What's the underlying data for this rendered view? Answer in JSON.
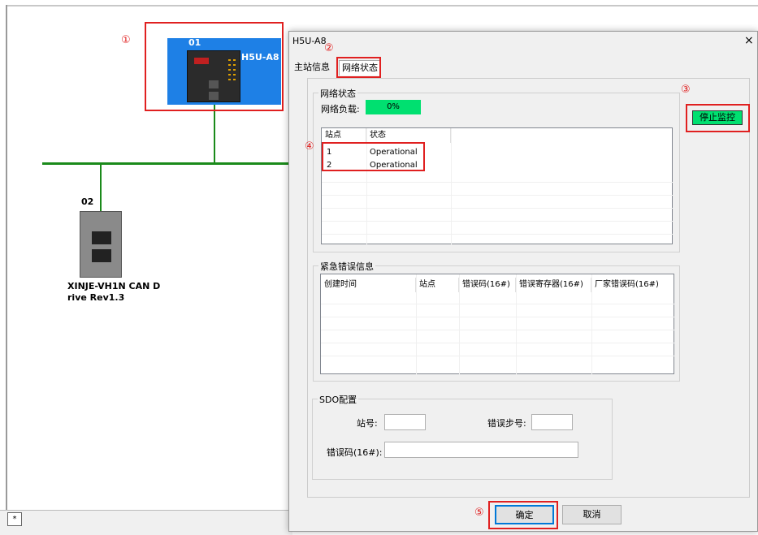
{
  "canvas": {
    "device1": {
      "number": "01",
      "name": "H5U-A8"
    },
    "device2": {
      "number": "02",
      "name_line1": "XINJE-VH1N CAN D",
      "name_line2": "rive Rev1.3"
    },
    "bottom_tab": "*"
  },
  "annotations": {
    "c1": "①",
    "c2": "②",
    "c3": "③",
    "c4": "④",
    "c5": "⑤"
  },
  "dialog": {
    "title": "H5U-A8",
    "close": "×",
    "tabs": [
      {
        "label": "主站信息"
      },
      {
        "label": "网络状态"
      }
    ],
    "network": {
      "group_title": "网络状态",
      "load_label": "网络负载:",
      "load_value": "0%",
      "columns": [
        "站点",
        "状态"
      ],
      "rows": [
        {
          "station": "1",
          "state": "Operational"
        },
        {
          "station": "2",
          "state": "Operational"
        }
      ]
    },
    "stop_button": "停止监控",
    "emergency": {
      "group_title": "紧急错误信息",
      "columns": [
        "创建时间",
        "站点",
        "错误码(16#)",
        "错误寄存器(16#)",
        "厂家错误码(16#)"
      ]
    },
    "sdo": {
      "group_title": "SDO配置",
      "station_label": "站号:",
      "step_label": "错误步号:",
      "code_label": "错误码(16#):",
      "station_value": "",
      "step_value": "",
      "code_value": ""
    },
    "ok": "确定",
    "cancel": "取消"
  },
  "colors": {
    "accent_red": "#e02020",
    "load_bar": "#00e070",
    "device_blue": "#1e80e6",
    "bus_green": "#1a8a1a"
  }
}
